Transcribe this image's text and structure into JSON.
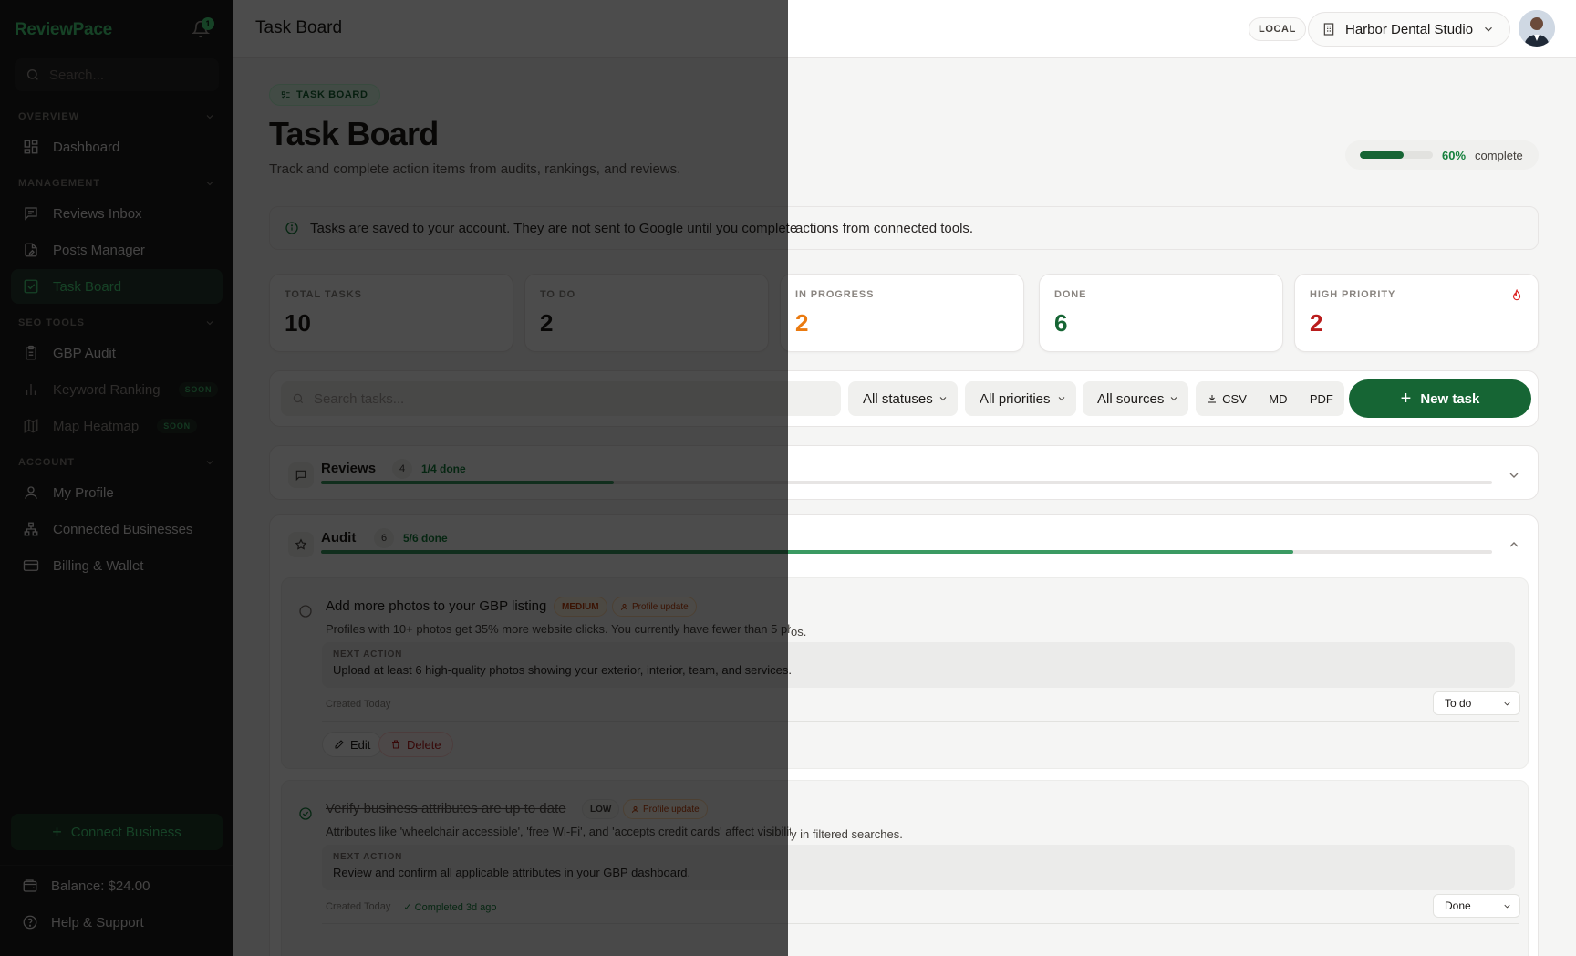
{
  "app": {
    "brand": "ReviewPace",
    "notifications_count": "1"
  },
  "sidebar": {
    "search_placeholder": "Search...",
    "sections": {
      "overview": "OVERVIEW",
      "management": "MANAGEMENT",
      "seo_tools": "SEO TOOLS",
      "account": "ACCOUNT"
    },
    "items": {
      "dashboard": "Dashboard",
      "reviews_inbox": "Reviews Inbox",
      "posts_manager": "Posts Manager",
      "task_board": "Task Board",
      "gbp_audit": "GBP Audit",
      "keyword_ranking": "Keyword Ranking",
      "map_heatmap": "Map Heatmap",
      "my_profile": "My Profile",
      "connected_businesses": "Connected Businesses",
      "billing_wallet": "Billing & Wallet"
    },
    "soon_label": "SOON",
    "connect_business": "Connect Business",
    "balance": "Balance: $24.00",
    "help": "Help & Support"
  },
  "topbar": {
    "title": "Task Board",
    "env": "LOCAL",
    "business": "Harbor Dental Studio"
  },
  "page": {
    "badge": "TASK BOARD",
    "title": "Task Board",
    "subtitle": "Track and complete action items from audits, rankings, and reviews.",
    "progress_pct": "60%",
    "progress_value": 0.6,
    "progress_word": "complete",
    "notice_a": "Tasks are saved to your account. They are not sent to Google until you complete",
    "notice_b": "actions from connected tools."
  },
  "stats": [
    {
      "label": "TOTAL TASKS",
      "value": "10",
      "color": "#1c1917"
    },
    {
      "label": "TO DO",
      "value": "2",
      "color": "#1c1917"
    },
    {
      "label": "IN PROGRESS",
      "value": "2",
      "color": "#ea7a10"
    },
    {
      "label": "DONE",
      "value": "6",
      "color": "#166534"
    },
    {
      "label": "HIGH PRIORITY",
      "value": "2",
      "color": "#b91c1c"
    }
  ],
  "toolbar": {
    "search_placeholder": "Search tasks...",
    "status_filter": "All statuses",
    "priority_filter": "All priorities",
    "source_filter": "All sources",
    "export_csv": "CSV",
    "export_md": "MD",
    "export_pdf": "PDF",
    "new_task": "New task"
  },
  "groups": {
    "reviews": {
      "title": "Reviews",
      "count": "4",
      "done": "1/4 done",
      "progress": 0.25
    },
    "audit": {
      "title": "Audit",
      "count": "6",
      "done": "5/6 done",
      "progress": 0.83
    }
  },
  "tasks": [
    {
      "title": "Add more photos to your GBP listing",
      "priority": "MEDIUM",
      "source": "Profile update",
      "desc_a": "Profiles with 10+ photos get 35% more website clicks. You currently have fewer than 5 phot",
      "desc_b": "os.",
      "next_label": "NEXT ACTION",
      "next_action": "Upload at least 6 high-quality photos showing your exterior, interior, team, and services.",
      "created": "Created Today",
      "status": "To do",
      "edit": "Edit",
      "delete": "Delete"
    },
    {
      "title": "Verify business attributes are up to date",
      "priority": "LOW",
      "source": "Profile update",
      "desc_a": "Attributes like 'wheelchair accessible', 'free Wi-Fi', and 'accepts credit cards' affect visibilit",
      "desc_b": "y in filtered searches.",
      "next_label": "NEXT ACTION",
      "next_action": "Review and confirm all applicable attributes in your GBP dashboard.",
      "created": "Created Today",
      "completed": "✓ Completed 3d ago",
      "status": "Done"
    }
  ]
}
